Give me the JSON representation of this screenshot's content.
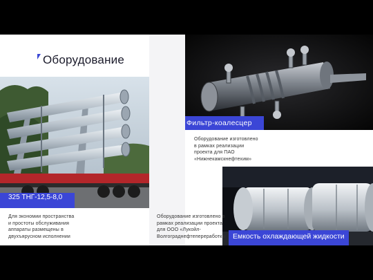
{
  "slide": {
    "title": "Оборудование"
  },
  "cards": [
    {
      "name": "Фильтр-коалесцер",
      "description": "Оборудование изготовлено в рамках реализации проекта для ПАО «Нижнекамскнефтехим»"
    },
    {
      "name": "325 ТНГ-12,5-8,0",
      "description": "Для экономии пространства и простоты обслуживания аппараты размещены в двухъярусном исполнении"
    },
    {
      "name": "Емкость охлаждающей жидкости",
      "description": "Оборудование изготовлено в рамках реализации проекта для ООО «Лукойл-Волгограднефтепереработка»"
    }
  ],
  "colors": {
    "accent": "#3b46d6",
    "background": "#ffffff",
    "letterbox": "#000000"
  },
  "icons": {
    "title_mark": "blue-corner-mark"
  }
}
